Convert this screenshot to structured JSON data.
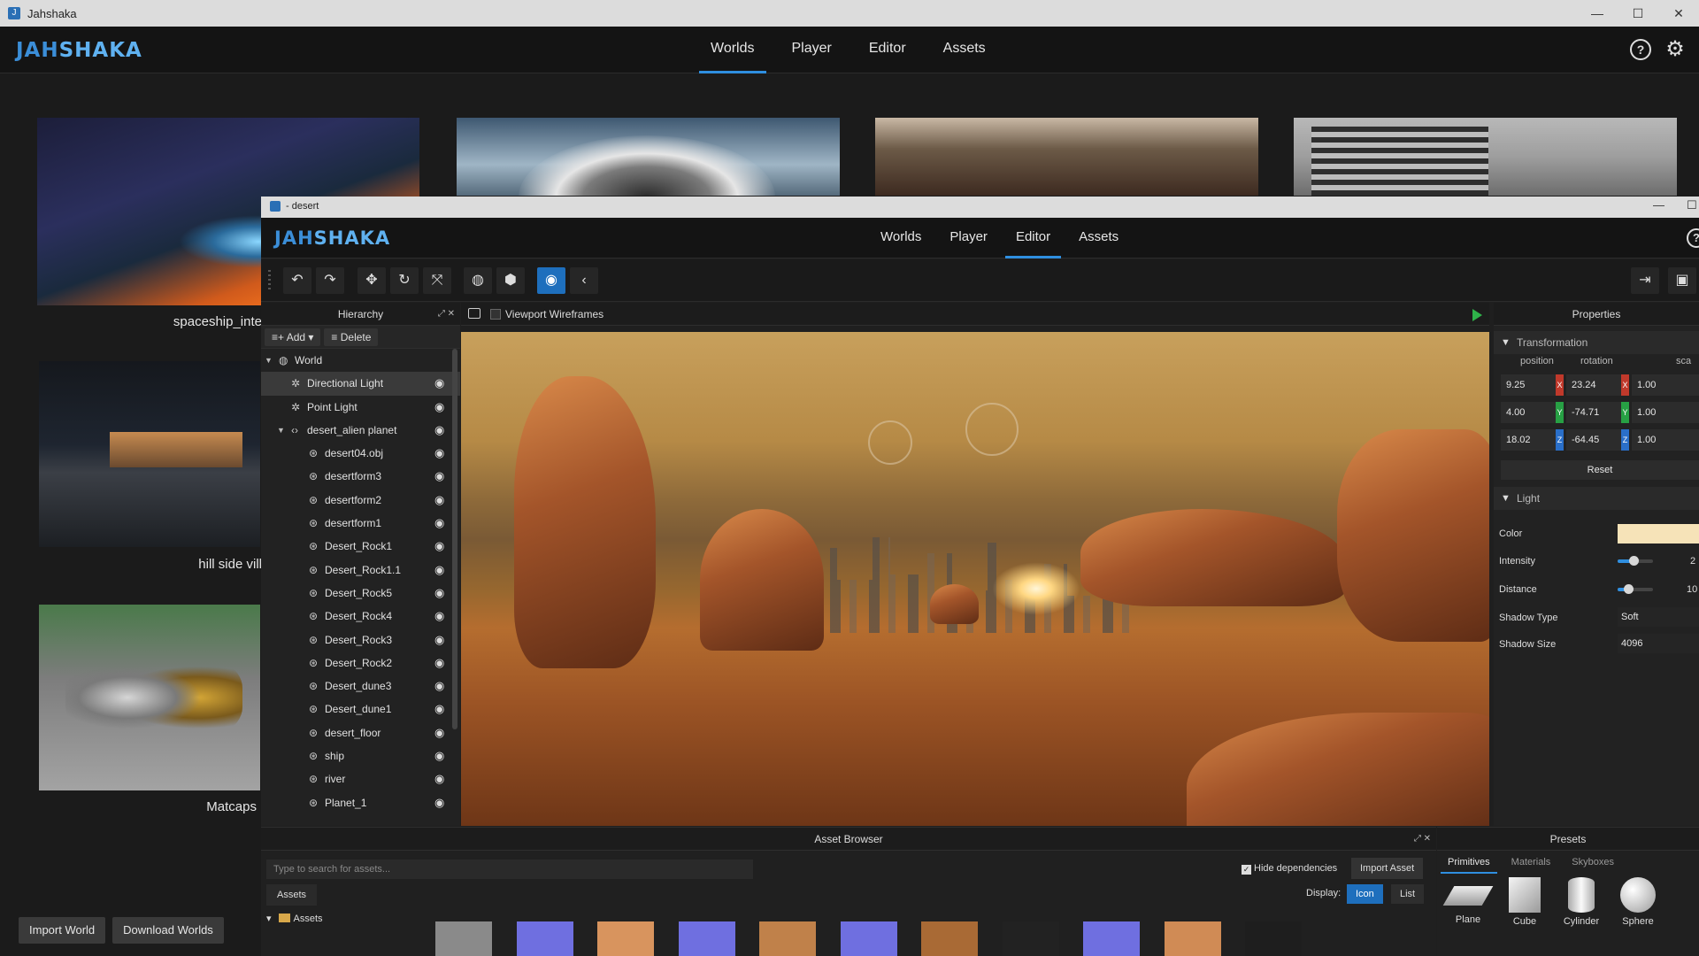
{
  "window": {
    "title": "Jahshaka",
    "minimize": "—",
    "maximize": "☐",
    "close": "✕"
  },
  "logo": {
    "part1": "JAH",
    "part2": "SHAKA"
  },
  "main_nav": {
    "tabs": [
      "Worlds",
      "Player",
      "Editor",
      "Assets"
    ],
    "active": "Worlds"
  },
  "header_icons": {
    "help": "?",
    "settings": "⚙"
  },
  "gallery": {
    "labels": [
      "spaceship_inte",
      "hill side vill",
      "Matcaps"
    ]
  },
  "gallery_buttons": {
    "import": "Import World",
    "download": "Download Worlds"
  },
  "editor": {
    "title": "- desert",
    "nav": [
      "Worlds",
      "Player",
      "Editor",
      "Assets"
    ],
    "active_tab": "Editor",
    "toolbar": {
      "undo": "↶",
      "redo": "↷",
      "translate": "✥",
      "rotate": "↻",
      "scale": "⤧",
      "global": "◍",
      "local": "⬢",
      "view": "◉",
      "collapse": "‹",
      "export": "⇥",
      "save": "▣"
    },
    "hierarchy": {
      "title": "Hierarchy",
      "add": "Add",
      "delete": "Delete",
      "items": [
        {
          "label": "World",
          "icon": "◍",
          "caret": "▼",
          "level": 0
        },
        {
          "label": "Directional Light",
          "icon": "✲",
          "level": 1,
          "selected": true,
          "eye": "◉"
        },
        {
          "label": "Point Light",
          "icon": "✲",
          "level": 1,
          "eye": "◉"
        },
        {
          "label": "desert_alien planet",
          "icon": "‹›",
          "caret": "▼",
          "level": 1,
          "eye": "◉"
        },
        {
          "label": "desert04.obj",
          "icon": "⊛",
          "level": 2,
          "eye": "◉"
        },
        {
          "label": "desertform3",
          "icon": "⊛",
          "level": 2,
          "eye": "◉"
        },
        {
          "label": "desertform2",
          "icon": "⊛",
          "level": 2,
          "eye": "◉"
        },
        {
          "label": "desertform1",
          "icon": "⊛",
          "level": 2,
          "eye": "◉"
        },
        {
          "label": "Desert_Rock1",
          "icon": "⊛",
          "level": 2,
          "eye": "◉"
        },
        {
          "label": "Desert_Rock1.1",
          "icon": "⊛",
          "level": 2,
          "eye": "◉"
        },
        {
          "label": "Desert_Rock5",
          "icon": "⊛",
          "level": 2,
          "eye": "◉"
        },
        {
          "label": "Desert_Rock4",
          "icon": "⊛",
          "level": 2,
          "eye": "◉"
        },
        {
          "label": "Desert_Rock3",
          "icon": "⊛",
          "level": 2,
          "eye": "◉"
        },
        {
          "label": "Desert_Rock2",
          "icon": "⊛",
          "level": 2,
          "eye": "◉"
        },
        {
          "label": "Desert_dune3",
          "icon": "⊛",
          "level": 2,
          "eye": "◉"
        },
        {
          "label": "Desert_dune1",
          "icon": "⊛",
          "level": 2,
          "eye": "◉"
        },
        {
          "label": "desert_floor",
          "icon": "⊛",
          "level": 2,
          "eye": "◉"
        },
        {
          "label": "ship",
          "icon": "⊛",
          "level": 2,
          "eye": "◉"
        },
        {
          "label": "river",
          "icon": "⊛",
          "level": 2,
          "eye": "◉"
        },
        {
          "label": "Planet_1",
          "icon": "⊛",
          "level": 2,
          "eye": "◉"
        }
      ]
    },
    "viewport": {
      "wireframes_label": "Viewport Wireframes"
    },
    "properties": {
      "title": "Properties",
      "transformation": {
        "title": "Transformation",
        "columns": [
          "position",
          "rotation",
          "sca"
        ],
        "position": [
          "9.25",
          "4.00",
          "18.02"
        ],
        "rotation": [
          "23.24",
          "-74.71",
          "-64.45"
        ],
        "scale": [
          "1.00",
          "1.00",
          "1.00"
        ],
        "axes": [
          "X",
          "Y",
          "Z"
        ],
        "reset": "Reset"
      },
      "light": {
        "title": "Light",
        "color_label": "Color",
        "color_value": "#f6e3b8",
        "intensity_label": "Intensity",
        "intensity_value": "2",
        "intensity_level": 0.45,
        "distance_label": "Distance",
        "distance_value": "10",
        "distance_level": 0.3,
        "shadow_type_label": "Shadow Type",
        "shadow_type_value": "Soft",
        "shadow_size_label": "Shadow Size",
        "shadow_size_value": "4096"
      }
    },
    "asset_browser": {
      "title": "Asset Browser",
      "search_placeholder": "Type to search for assets...",
      "hide_dependencies": "Hide dependencies",
      "import": "Import Asset",
      "assets_tab": "Assets",
      "display_label": "Display:",
      "display_icon": "Icon",
      "display_list": "List",
      "folder": "Assets",
      "swatch_colors": [
        "#8a8a8a",
        "#6f6fe0",
        "#d8945e",
        "#6f6fe0",
        "#c0814a",
        "#6f6fe0",
        "#a96a35",
        "#222222",
        "#6f6fe0",
        "#d08b55",
        "#1e1e1e"
      ]
    },
    "presets": {
      "title": "Presets",
      "tabs": [
        "Primitives",
        "Materials",
        "Skyboxes"
      ],
      "active_tab": "Primitives",
      "primitives": [
        "Plane",
        "Cube",
        "Cylinder",
        "Sphere"
      ]
    }
  }
}
